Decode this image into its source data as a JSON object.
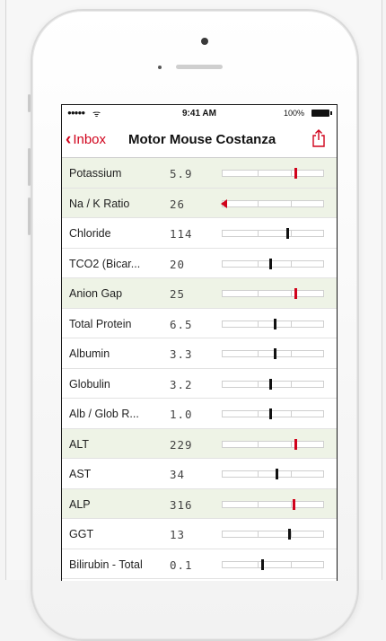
{
  "status": {
    "signal": "●●●●●",
    "wifi": "ᯤ",
    "time": "9:41 AM",
    "battery": "100%"
  },
  "nav": {
    "back_chevron": "‹",
    "back_label": "Inbox",
    "title": "Motor Mouse Costanza",
    "share_icon": "share-icon"
  },
  "colors": {
    "accent": "#d0021b",
    "alt_row": "#eef3e6",
    "normal_marker": "#111111"
  },
  "labs": [
    {
      "name": "Potassium",
      "value": "5.9",
      "level": 0.7,
      "flag": "high",
      "shaded": true
    },
    {
      "name": "Na / K Ratio",
      "value": "26",
      "level": 0.0,
      "flag": "low",
      "shaded": true
    },
    {
      "name": "Chloride",
      "value": "114",
      "level": 0.62,
      "flag": "normal",
      "shaded": false
    },
    {
      "name": "TCO2 (Bicar...",
      "value": "20",
      "level": 0.46,
      "flag": "normal",
      "shaded": false
    },
    {
      "name": "Anion Gap",
      "value": "25",
      "level": 0.7,
      "flag": "high",
      "shaded": true
    },
    {
      "name": "Total Protein",
      "value": "6.5",
      "level": 0.5,
      "flag": "normal",
      "shaded": false
    },
    {
      "name": "Albumin",
      "value": "3.3",
      "level": 0.5,
      "flag": "normal",
      "shaded": false
    },
    {
      "name": "Globulin",
      "value": "3.2",
      "level": 0.46,
      "flag": "normal",
      "shaded": false
    },
    {
      "name": "Alb / Glob R...",
      "value": "1.0",
      "level": 0.46,
      "flag": "normal",
      "shaded": false
    },
    {
      "name": "ALT",
      "value": "229",
      "level": 0.7,
      "flag": "high",
      "shaded": true
    },
    {
      "name": "AST",
      "value": "34",
      "level": 0.52,
      "flag": "normal",
      "shaded": false
    },
    {
      "name": "ALP",
      "value": "316",
      "level": 0.68,
      "flag": "high",
      "shaded": true
    },
    {
      "name": "GGT",
      "value": "13",
      "level": 0.64,
      "flag": "normal",
      "shaded": false
    },
    {
      "name": "Bilirubin - Total",
      "value": "0.1",
      "level": 0.38,
      "flag": "normal",
      "shaded": false
    }
  ]
}
